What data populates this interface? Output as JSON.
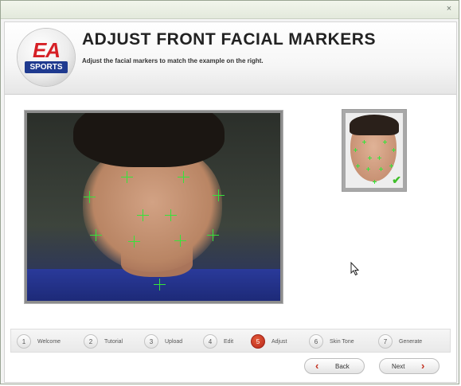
{
  "window": {
    "close_symbol": "×"
  },
  "header": {
    "logo_top": "EA",
    "logo_bottom": "SPORTS",
    "title": "ADJUST FRONT FACIAL MARKERS",
    "subtitle": "Adjust the facial markers to match the example on the right."
  },
  "steps": [
    {
      "number": "1",
      "label": "Welcome"
    },
    {
      "number": "2",
      "label": "Tutorial"
    },
    {
      "number": "3",
      "label": "Upload"
    },
    {
      "number": "4",
      "label": "Edit"
    },
    {
      "number": "5",
      "label": "Adjust",
      "active": true
    },
    {
      "number": "6",
      "label": "Skin Tone"
    },
    {
      "number": "7",
      "label": "Generate"
    }
  ],
  "buttons": {
    "back": "Back",
    "back_icon": "chevron-left-icon",
    "next": "Next",
    "next_icon": "chevron-right-icon"
  },
  "colors": {
    "accent": "#c4301f",
    "marker": "#35e43a",
    "brand_red": "#d62026",
    "brand_blue": "#1f3a8f"
  }
}
